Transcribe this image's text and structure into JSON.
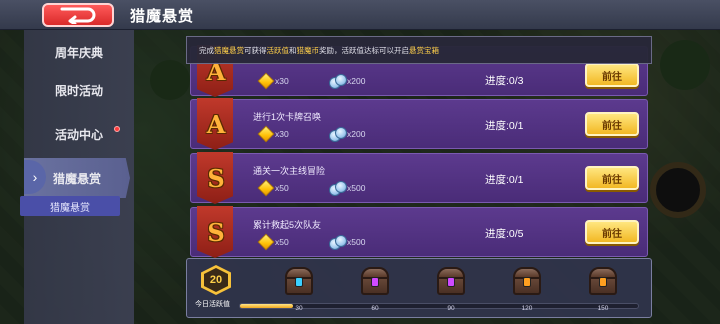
{
  "header": {
    "title": "猎魔悬赏"
  },
  "sidebar": {
    "items": [
      {
        "label": "周年庆典",
        "badge": false
      },
      {
        "label": "限时活动",
        "badge": false
      },
      {
        "label": "活动中心",
        "badge": true
      },
      {
        "label": "猎魔悬赏",
        "badge": false,
        "active": true
      }
    ],
    "sub_item": "猎魔悬赏"
  },
  "notice": {
    "prefix": "完成",
    "hl1": "猎魔悬赏",
    "mid1": "可获得",
    "hl2": "活跃值",
    "mid2": "和",
    "hl3": "猎魔币",
    "mid3": "奖励，活跃值达标可以开启",
    "hl4": "悬赏宝箱"
  },
  "tasks": [
    {
      "grade": "A",
      "desc": "",
      "reward1": "x30",
      "reward2": "x200",
      "progress_label": "进度:",
      "progress": "0/3",
      "button": "前往"
    },
    {
      "grade": "A",
      "desc": "进行1次卡牌召唤",
      "reward1": "x30",
      "reward2": "x200",
      "progress_label": "进度:",
      "progress": "0/1",
      "button": "前往"
    },
    {
      "grade": "S",
      "desc": "通关一次主线冒险",
      "reward1": "x50",
      "reward2": "x500",
      "progress_label": "进度:",
      "progress": "0/1",
      "button": "前往"
    },
    {
      "grade": "S",
      "desc": "累计救起5次队友",
      "reward1": "x50",
      "reward2": "x500",
      "progress_label": "进度:",
      "progress": "0/5",
      "button": "前往"
    }
  ],
  "activity": {
    "today_value": "20",
    "today_label": "今日活跃值",
    "progress_fraction": 0.133,
    "chests": [
      {
        "value": "30",
        "gem_color": "#3ad0ff"
      },
      {
        "value": "60",
        "gem_color": "#d04aff"
      },
      {
        "value": "90",
        "gem_color": "#d04aff"
      },
      {
        "value": "120",
        "gem_color": "#ffa020"
      },
      {
        "value": "150",
        "gem_color": "#ffa020"
      }
    ]
  },
  "colors": {
    "accent_gold": "#ffd04a",
    "task_bg": "#5c3a8e",
    "button_gold": "#f2b824"
  }
}
